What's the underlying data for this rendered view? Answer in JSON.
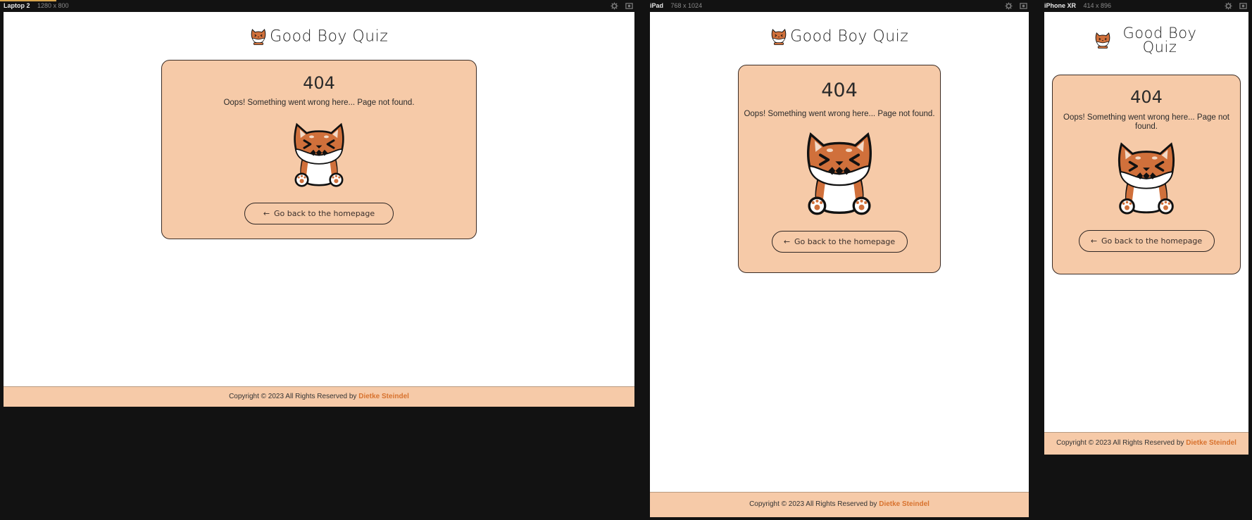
{
  "devices": [
    {
      "name": "Laptop 2",
      "size": "1280 x 800"
    },
    {
      "name": "iPad",
      "size": "768 x 1024"
    },
    {
      "name": "iPhone XR",
      "size": "414 x 896"
    }
  ],
  "site": {
    "title": "Good Boy Quiz",
    "logo_icon": "shiba-logo-icon"
  },
  "error": {
    "code": "404",
    "message": "Oops! Something went wrong here... Page not found.",
    "illustration": "angry-shiba-dog-icon",
    "button_label": "Go back to the homepage",
    "button_icon": "arrow-left-icon"
  },
  "footer": {
    "copyright": "Copyright © 2023 All Rights Reserved by",
    "author": "Dietke Steindel"
  },
  "colors": {
    "card_bg": "#f6caa8",
    "accent": "#d8722e",
    "dog_orange": "#d0703b",
    "device_chrome": "#121212"
  }
}
